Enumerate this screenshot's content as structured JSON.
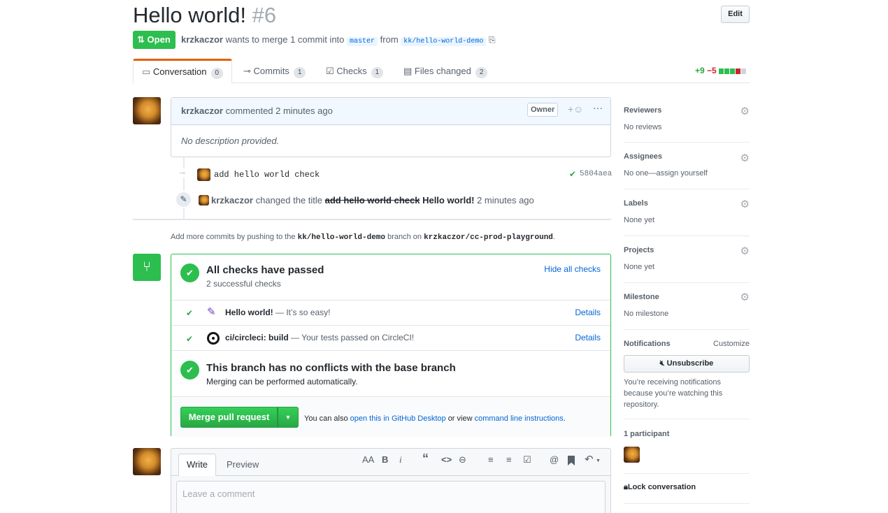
{
  "header": {
    "title": "Hello world!",
    "number": "#6",
    "edit_label": "Edit",
    "state": "Open",
    "author": "krzkaczor",
    "merge_text": "wants to merge 1 commit into",
    "base_branch": "master",
    "from_text": "from",
    "head_branch": "kk/hello-world-demo"
  },
  "tabs": [
    {
      "label": "Conversation",
      "count": "0"
    },
    {
      "label": "Commits",
      "count": "1"
    },
    {
      "label": "Checks",
      "count": "1"
    },
    {
      "label": "Files changed",
      "count": "2"
    }
  ],
  "diffstat": {
    "added": "+9",
    "removed": "−5"
  },
  "comment": {
    "author": "krzkaczor",
    "meta": "commented 2 minutes ago",
    "role": "Owner",
    "body": "No description provided."
  },
  "commit": {
    "message": "add hello world check",
    "sha": "5804aea"
  },
  "title_change": {
    "author": "krzkaczor",
    "text": "changed the title",
    "old_title": "add hello world check",
    "new_title": "Hello world!",
    "time": "2 minutes ago"
  },
  "push_hint": {
    "prefix": "Add more commits by pushing to the",
    "branch": "kk/hello-world-demo",
    "middle": "branch on",
    "repo": "krzkaczor/cc-prod-playground",
    "suffix": "."
  },
  "checks": {
    "title": "All checks have passed",
    "subtitle": "2 successful checks",
    "hide_label": "Hide all checks",
    "items": [
      {
        "name": "Hello world!",
        "desc": "— It’s so easy!",
        "details": "Details"
      },
      {
        "name": "ci/circleci: build",
        "desc": "— Your tests passed on CircleCI!",
        "details": "Details"
      }
    ]
  },
  "conflicts": {
    "title": "This branch has no conflicts with the base branch",
    "subtitle": "Merging can be performed automatically."
  },
  "merge": {
    "button_label": "Merge pull request",
    "also_text": "You can also",
    "desktop_link": "open this in GitHub Desktop",
    "or_view": "or view",
    "cli_link": "command line instructions",
    "suffix": "."
  },
  "editor": {
    "write_tab": "Write",
    "preview_tab": "Preview",
    "placeholder": "Leave a comment",
    "toolbar": {
      "heading": "AA",
      "bold": "B",
      "italic": "i",
      "quote": "“",
      "code": "<>",
      "link": "⊖",
      "ul": "≡",
      "ol": "≡",
      "tasks": "☑",
      "mention": "@",
      "bookmark": "🔖",
      "reply": "↶"
    }
  },
  "sidebar": {
    "reviewers": {
      "label": "Reviewers",
      "value": "No reviews"
    },
    "assignees": {
      "label": "Assignees",
      "value": "No one—assign yourself"
    },
    "labels": {
      "label": "Labels",
      "value": "None yet"
    },
    "projects": {
      "label": "Projects",
      "value": "None yet"
    },
    "milestone": {
      "label": "Milestone",
      "value": "No milestone"
    },
    "notifications": {
      "label": "Notifications",
      "customize": "Customize",
      "unsubscribe": "Unsubscribe",
      "reason": "You’re receiving notifications because you’re watching this repository."
    },
    "participants": {
      "label": "1 participant"
    },
    "lock": "Lock conversation"
  },
  "colors": {
    "green": "#2cbe4e",
    "link": "#0366d6",
    "red": "#cb2431"
  }
}
